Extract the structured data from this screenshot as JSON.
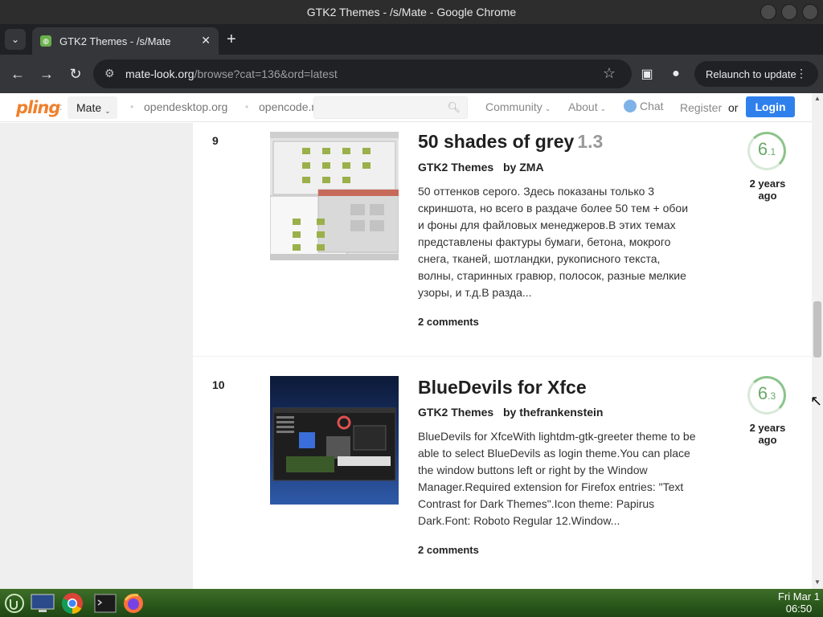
{
  "window": {
    "title": "GTK2 Themes - /s/Mate - Google Chrome"
  },
  "browser": {
    "tab_title": "GTK2 Themes - /s/Mate",
    "url_host": "mate-look.org",
    "url_path": "/browse?cat=136&ord=latest",
    "relaunch_label": "Relaunch to update"
  },
  "site": {
    "logo": "pling",
    "store": "Mate",
    "links": [
      "opendesktop.org",
      "opencode.net"
    ],
    "menu": {
      "community": "Community",
      "about": "About",
      "chat": "Chat"
    },
    "register": "Register",
    "or": "or",
    "login": "Login"
  },
  "items": [
    {
      "rank": "9",
      "title": "50 shades of grey",
      "version": "1.3",
      "category": "GTK2 Themes",
      "author": "by ZMA",
      "description": "50 оттенков серого. Здесь показаны только 3 скриншота, но всего в раздаче более 50 тем + обои и фоны для файловых менеджеров.В этих темах представлены фактуры бумаги, бетона, мокрого снега, тканей, шотландки, рукописного текста, волны, старинных гравюр, полосок, разные мелкие узоры, и т.д.В разда...",
      "comments": "2 comments",
      "score_major": "6",
      "score_minor": ".1",
      "age": "2 years ago"
    },
    {
      "rank": "10",
      "title": "BlueDevils for Xfce",
      "version": "",
      "category": "GTK2 Themes",
      "author": "by thefrankenstein",
      "description": "BlueDevils for XfceWith lightdm-gtk-greeter theme to be able to select BlueDevils as login theme.You can place the window buttons left or right by the Window Manager.Required extension for Firefox entries: \"Text Contrast for Dark Themes\".Icon theme: Papirus Dark.Font: Roboto Regular 12.Window...",
      "comments": "2 comments",
      "score_major": "6",
      "score_minor": ".3",
      "age": "2 years ago"
    }
  ],
  "taskbar": {
    "date": "Fri Mar 1",
    "time": "06:50"
  }
}
